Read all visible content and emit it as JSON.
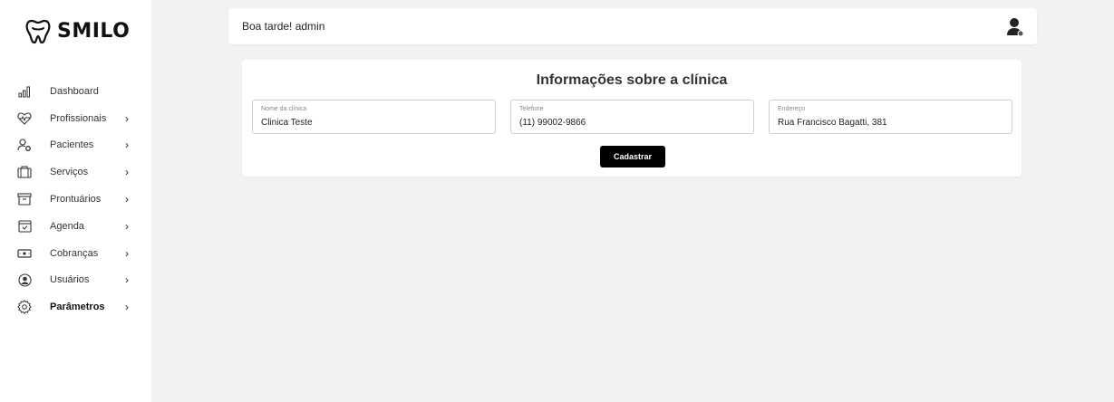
{
  "app": {
    "logo_text": "SMILO"
  },
  "sidebar": {
    "items": [
      {
        "label": "Dashboard",
        "icon": "bar-chart-icon",
        "chevron": false
      },
      {
        "label": "Profissionais",
        "icon": "heart-pulse-icon",
        "chevron": true
      },
      {
        "label": "Pacientes",
        "icon": "user-settings-icon",
        "chevron": true
      },
      {
        "label": "Serviços",
        "icon": "briefcase-icon",
        "chevron": true
      },
      {
        "label": "Prontuários",
        "icon": "archive-icon",
        "chevron": true
      },
      {
        "label": "Agenda",
        "icon": "calendar-check-icon",
        "chevron": true
      },
      {
        "label": "Cobranças",
        "icon": "money-icon",
        "chevron": true
      },
      {
        "label": "Usuários",
        "icon": "user-circle-icon",
        "chevron": true
      },
      {
        "label": "Parâmetros",
        "icon": "gear-icon",
        "chevron": true,
        "active": true
      }
    ],
    "chevron_glyph": "›"
  },
  "header": {
    "greeting": "Boa tarde! admin",
    "avatar_icon": "user-avatar-icon"
  },
  "form": {
    "title": "Informações sobre a clínica",
    "fields": [
      {
        "label": "Nome da clínica",
        "value": "Clinica Teste"
      },
      {
        "label": "Telefone",
        "value": "(11) 99002-9866"
      },
      {
        "label": "Endereço",
        "value": "Rua Francisco Bagatti, 381"
      }
    ],
    "submit_label": "Cadastrar"
  },
  "colors": {
    "background": "#f2f2f2",
    "surface": "#ffffff",
    "button": "#000000",
    "text": "#222222"
  }
}
